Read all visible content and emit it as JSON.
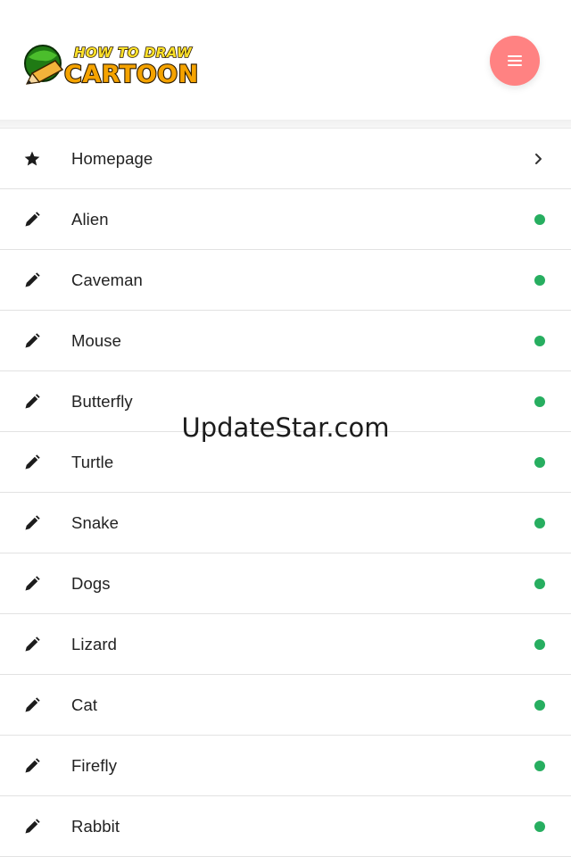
{
  "header": {
    "logo": {
      "line1": "HOW TO DRAW",
      "line2": "CARTOON",
      "icon": "green-pencil-globe-icon"
    },
    "menu_button_icon": "hamburger-menu-icon"
  },
  "nav": {
    "items": [
      {
        "label": "Homepage",
        "icon": "star-icon",
        "trailing": "chevron-right-icon"
      },
      {
        "label": "Alien",
        "icon": "pencil-icon",
        "trailing": "status-dot"
      },
      {
        "label": "Caveman",
        "icon": "pencil-icon",
        "trailing": "status-dot"
      },
      {
        "label": "Mouse",
        "icon": "pencil-icon",
        "trailing": "status-dot"
      },
      {
        "label": "Butterfly",
        "icon": "pencil-icon",
        "trailing": "status-dot"
      },
      {
        "label": "Turtle",
        "icon": "pencil-icon",
        "trailing": "status-dot"
      },
      {
        "label": "Snake",
        "icon": "pencil-icon",
        "trailing": "status-dot"
      },
      {
        "label": "Dogs",
        "icon": "pencil-icon",
        "trailing": "status-dot"
      },
      {
        "label": "Lizard",
        "icon": "pencil-icon",
        "trailing": "status-dot"
      },
      {
        "label": "Cat",
        "icon": "pencil-icon",
        "trailing": "status-dot"
      },
      {
        "label": "Firefly",
        "icon": "pencil-icon",
        "trailing": "status-dot"
      },
      {
        "label": "Rabbit",
        "icon": "pencil-icon",
        "trailing": "status-dot"
      }
    ]
  },
  "watermark": "UpdateStar.com",
  "colors": {
    "menu_button": "#ff8282",
    "status_dot": "#27ae60",
    "text": "#222222",
    "divider": "#e2e2e2"
  }
}
